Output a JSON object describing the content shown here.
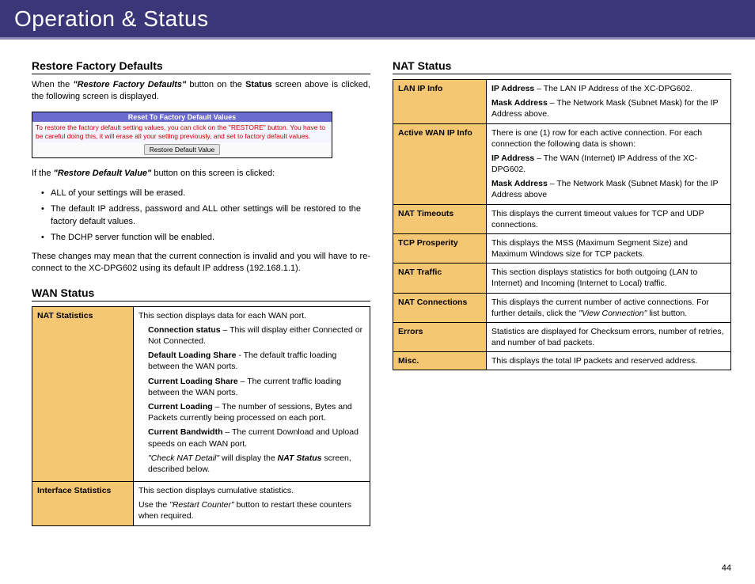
{
  "banner": {
    "title": "Operation & Status"
  },
  "pagenum": "44",
  "restore": {
    "heading": "Restore Factory Defaults",
    "intro_pre": "When the ",
    "intro_bold": "\"Restore Factory Defaults\"",
    "intro_post": " button on the ",
    "intro_status": "Status",
    "intro_end": " screen above is clicked, the following screen is displayed.",
    "fig_title": "Reset To Factory Default Values",
    "fig_body": "To restore the factory default setting values, you can click on the \"RESTORE\" button. You have to be careful doing this, it will erase all your setting previously, and set to factory default values.",
    "fig_button": "Restore Default Value",
    "after_pre": "If the ",
    "after_bold": "\"Restore Default Value\"",
    "after_post": " button on this screen is clicked:",
    "bullets": [
      "ALL of your settings will be erased.",
      "The default IP address, password and ALL other settings will be restored to the factory default values.",
      "The DCHP server function will be enabled."
    ],
    "changes": "These changes may mean that the current connection is invalid and you will have to re-connect to the XC-DPG602 using its default IP address (192.168.1.1)."
  },
  "wan": {
    "heading": "WAN Status",
    "rows": {
      "r1_label": "NAT Statistics",
      "r1_intro": "This section displays data for each WAN port.",
      "r1_items": [
        {
          "b": "Connection status",
          "t": " – This will display either Connected or Not Connected."
        },
        {
          "b": "Default Loading Share",
          "t": " - The default traffic loading between the WAN ports."
        },
        {
          "b": "Current Loading Share",
          "t": " – The current traffic loading between the WAN ports."
        },
        {
          "b": "Current Loading",
          "t": " – The number of sessions, Bytes and Packets currently being processed on each port."
        },
        {
          "b": "Current Bandwidth",
          "t": " – The current Download and Upload speeds on each WAN port."
        }
      ],
      "r1_tail_i1": "\"Check NAT Detail\"",
      "r1_tail_mid": " will display the ",
      "r1_tail_b": "NAT Status",
      "r1_tail_end": " screen, described below.",
      "r2_label": "Interface Statistics",
      "r2_intro": "This section displays cumulative statistics.",
      "r2_tail_pre": "Use the ",
      "r2_tail_i": "\"Restart Counter\"",
      "r2_tail_post": " button to restart these counters when required."
    }
  },
  "nat": {
    "heading": "NAT Status",
    "rows": {
      "lan_label": "LAN IP Info",
      "lan_ip_b": "IP Address",
      "lan_ip_t": " – The LAN IP Address of the XC-DPG602.",
      "lan_mask_b": "Mask Address",
      "lan_mask_t": " – The Network Mask (Subnet Mask) for the IP Address above.",
      "wanip_label": "Active WAN IP Info",
      "wanip_intro": "There is one (1) row for each active connection. For each connection the following data is shown:",
      "wanip_ip_b": "IP Address",
      "wanip_ip_t": " – The WAN (Internet) IP Address of the XC-DPG602.",
      "wanip_mask_b": "Mask Address",
      "wanip_mask_t": " – The Network Mask (Subnet Mask) for the IP Address above",
      "to_label": "NAT Timeouts",
      "to_t": "This displays the current timeout values for TCP and UDP connections.",
      "tcp_label": "TCP Prosperity",
      "tcp_t": "This displays the MSS (Maximum Segment Size) and Maximum Windows size for TCP packets.",
      "tr_label": "NAT Traffic",
      "tr_t": "This section displays statistics for both outgoing (LAN to Internet) and Incoming (Internet to Local) traffic.",
      "nc_label": "NAT Connections",
      "nc_pre": "This displays the current number of active connections. For further details, click the ",
      "nc_i": "\"View Connection\"",
      "nc_post": " list button.",
      "err_label": "Errors",
      "err_t": "Statistics are displayed for Checksum errors, number of retries, and number of bad packets.",
      "misc_label": "Misc.",
      "misc_t": "This displays the total IP packets and reserved address."
    }
  }
}
